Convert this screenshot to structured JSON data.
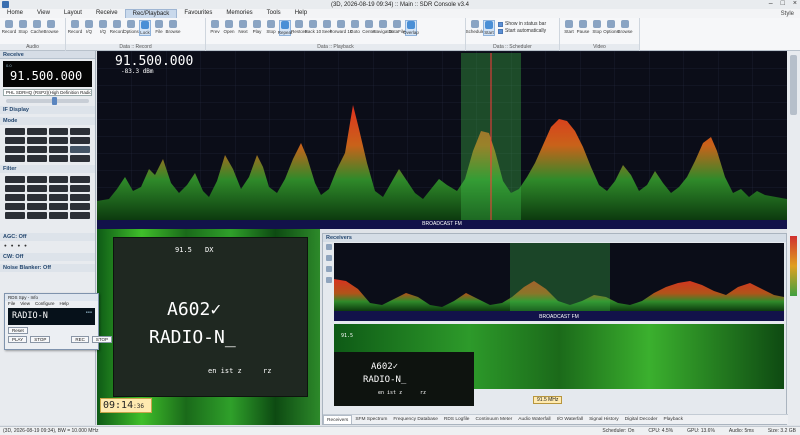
{
  "window": {
    "title": "(3D, 2026-08-19 09:34) :: Main :: SDR Console v3.4",
    "style_label": "Style"
  },
  "menu": [
    "Home",
    "View",
    "Layout",
    "Receive",
    "Rec/Playback",
    "Favourites",
    "Memories",
    "Tools",
    "Help"
  ],
  "menu_active": 4,
  "ribbon": {
    "audio": {
      "group": "Audio",
      "buttons": [
        "Record",
        "Stop",
        "Cache",
        "Browse"
      ]
    },
    "record": {
      "group": "Data :: Record",
      "buttons": [
        "Record",
        "I/Q",
        "I/Q",
        "Record",
        "Options",
        "Lock",
        "File",
        "Browse"
      ]
    },
    "playback": {
      "group": "Data :: Playback",
      "buttons": [
        "Prev",
        "Open",
        "Next",
        "Play",
        "Stop",
        "Repeat",
        "Restore",
        "Back 10",
        "Seek",
        "Forward 10",
        "Goto",
        "Center",
        "Navigator",
        "DataFile",
        "Overlap"
      ]
    },
    "scheduler": {
      "group": "Data :: Scheduler",
      "buttons": [
        "Schedule",
        "Start"
      ],
      "checks": [
        "Show in status bar",
        "Start automatically"
      ]
    },
    "video": {
      "group": "Video",
      "buttons": [
        "Start",
        "Pause",
        "Stop",
        "Options",
        "Browse"
      ]
    }
  },
  "left": {
    "receive_header": "Receive",
    "vfo_freq": "91.500.000",
    "vfo_prefix": "0.0",
    "device": "PHL SDRHQ (RSP2)(High Definition Radio)",
    "if_display": "IF Display",
    "mode_header": "Mode",
    "modes": [
      "",
      "",
      "",
      "",
      "",
      "",
      "",
      "",
      "",
      "",
      "",
      "",
      "",
      "",
      "",
      "",
      ""
    ],
    "filter_header": "Filter",
    "agc": "AGC: Off",
    "cw": "CW: Off",
    "noise_blanker": "Noise Blanker: Off"
  },
  "spectrum": {
    "frequency": "91.500.000",
    "db": "-83.3 dBm",
    "band": "BROADCAST FM"
  },
  "waterfall": {
    "station": "91.5",
    "dx": "DX",
    "rds1": "A602✓",
    "rds2": "RADIO-N_",
    "rt": "en ist z",
    "rz": "rz",
    "clock": "09:14",
    "clock_sec": ":36"
  },
  "receivers": {
    "header": "Receivers",
    "band": "BROADCAST FM",
    "station": "91.5",
    "rds1": "A602✓",
    "rds2": "RADIO-N_",
    "rt": "en ist z",
    "rz": "rz",
    "marker": "91.5 MHz",
    "tabs": [
      "Receivers",
      "SFM Spectrum",
      "Frequency Database",
      "RDS Logfile",
      "Continuum Meter",
      "Audio Waterfall",
      "I/O Waterfall",
      "Signal History",
      "Digital Decoder",
      "Playback"
    ]
  },
  "popup": {
    "title": "RDS Spy - Info",
    "menu": [
      "File",
      "View",
      "Configure",
      "Help"
    ],
    "display": "RADIO-N",
    "reset": "Reset",
    "play": "PLAY",
    "stop": "STOP",
    "rec": "REC",
    "stop2": "STOP"
  },
  "status": {
    "left": "(3D, 2026-08-19 09:34), BW = 10.000 MHz",
    "scheduler": "Scheduler: On",
    "cpu": "CPU: 4.5%",
    "gpu": "GPU: 13.6%",
    "audio": "Audio: 5ms",
    "size": "Size: 3.2 GB"
  },
  "colors": {
    "spectrum_bg": "#0b0d18",
    "band_bar": "#12124a",
    "waterfall_green": "#1f8a2a",
    "accent": "#3a6fb0"
  }
}
